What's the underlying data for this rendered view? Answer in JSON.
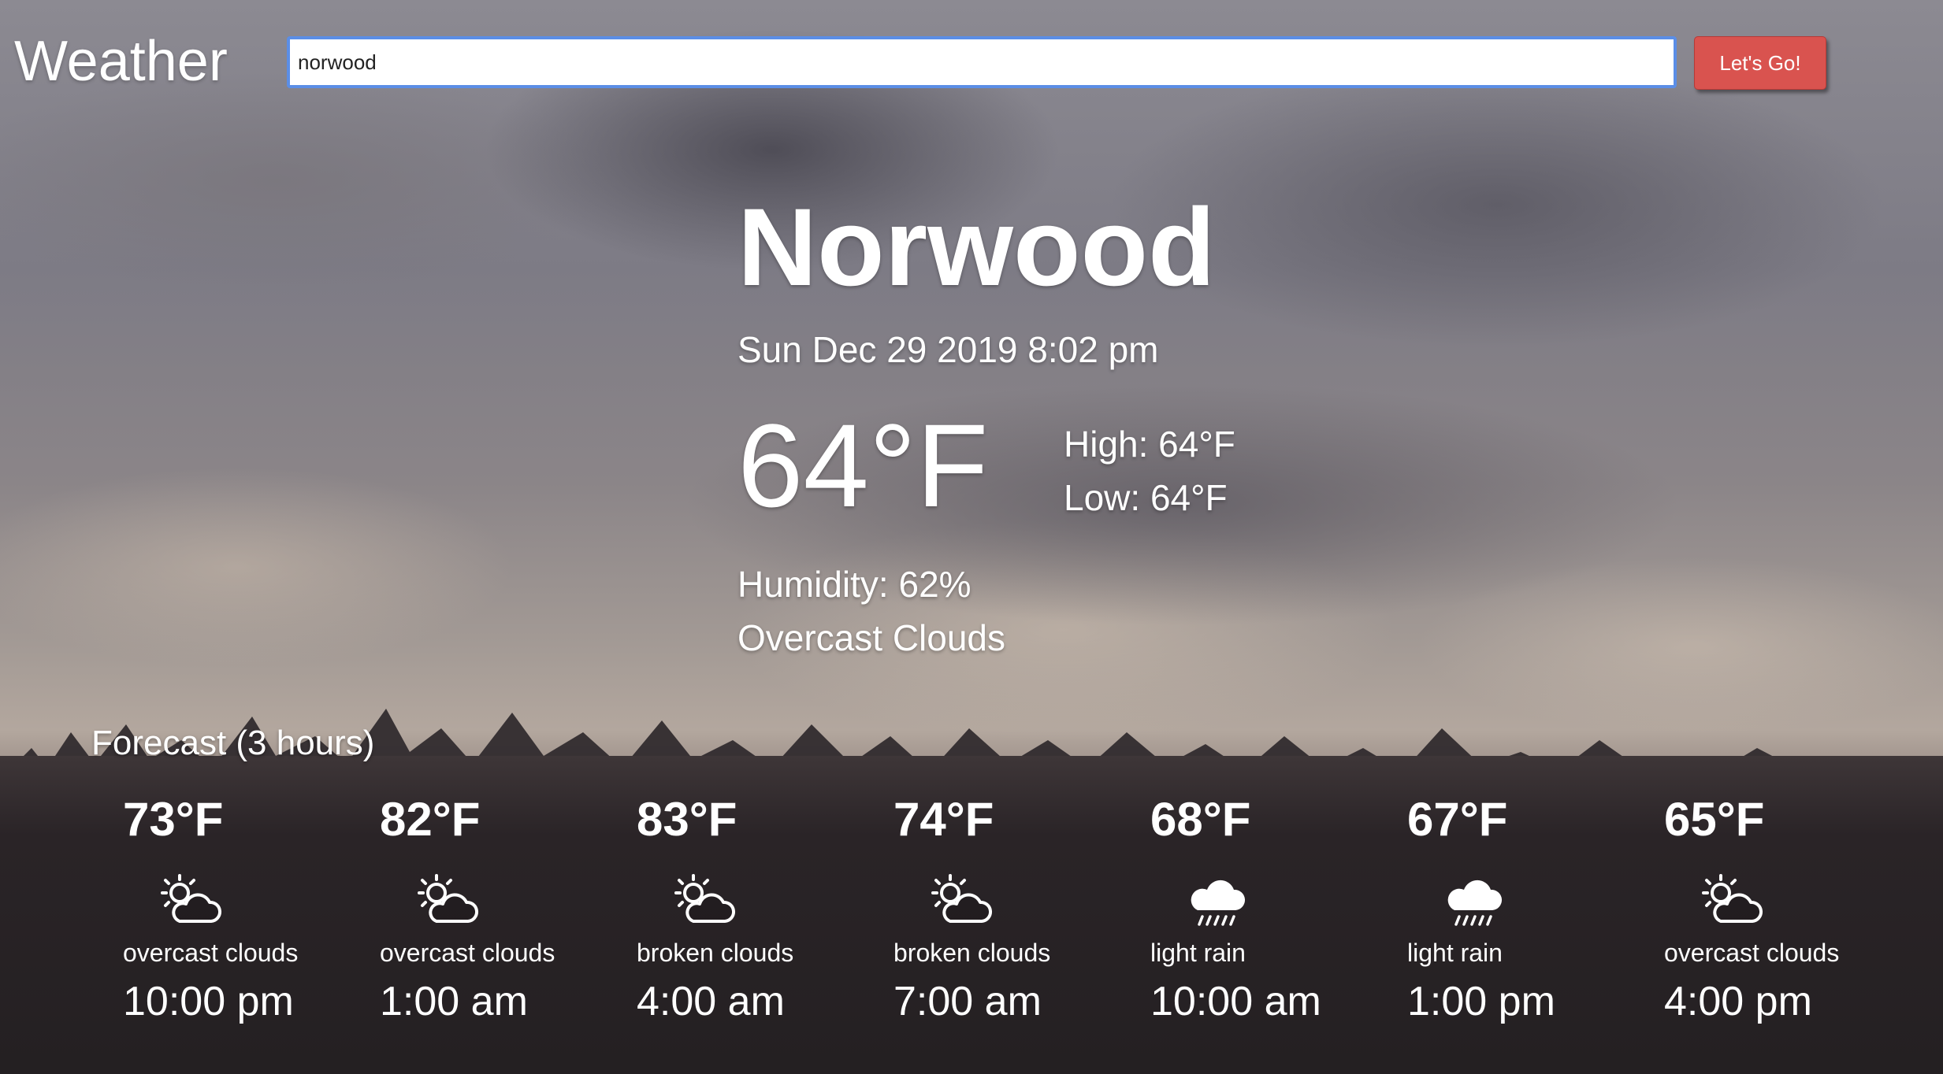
{
  "header": {
    "brand": "Weather",
    "search_value": "norwood",
    "search_button_label": "Let's Go!"
  },
  "current": {
    "city": "Norwood",
    "datetime": "Sun Dec 29 2019 8:02 pm",
    "temperature": "64°F",
    "high": "High: 64°F",
    "low": "Low: 64°F",
    "humidity": "Humidity: 62%",
    "condition": "Overcast Clouds"
  },
  "forecast": {
    "title": "Forecast (3 hours)",
    "items": [
      {
        "temp": "73°F",
        "icon": "partly-cloudy-icon",
        "desc": "overcast clouds",
        "time": "10:00 pm"
      },
      {
        "temp": "82°F",
        "icon": "partly-cloudy-icon",
        "desc": "overcast clouds",
        "time": "1:00 am"
      },
      {
        "temp": "83°F",
        "icon": "partly-cloudy-icon",
        "desc": "broken clouds",
        "time": "4:00 am"
      },
      {
        "temp": "74°F",
        "icon": "partly-cloudy-icon",
        "desc": "broken clouds",
        "time": "7:00 am"
      },
      {
        "temp": "68°F",
        "icon": "rain-cloud-icon",
        "desc": "light rain",
        "time": "10:00 am"
      },
      {
        "temp": "67°F",
        "icon": "rain-cloud-icon",
        "desc": "light rain",
        "time": "1:00 pm"
      },
      {
        "temp": "65°F",
        "icon": "partly-cloudy-icon",
        "desc": "overcast clouds",
        "time": "4:00 pm"
      }
    ]
  }
}
